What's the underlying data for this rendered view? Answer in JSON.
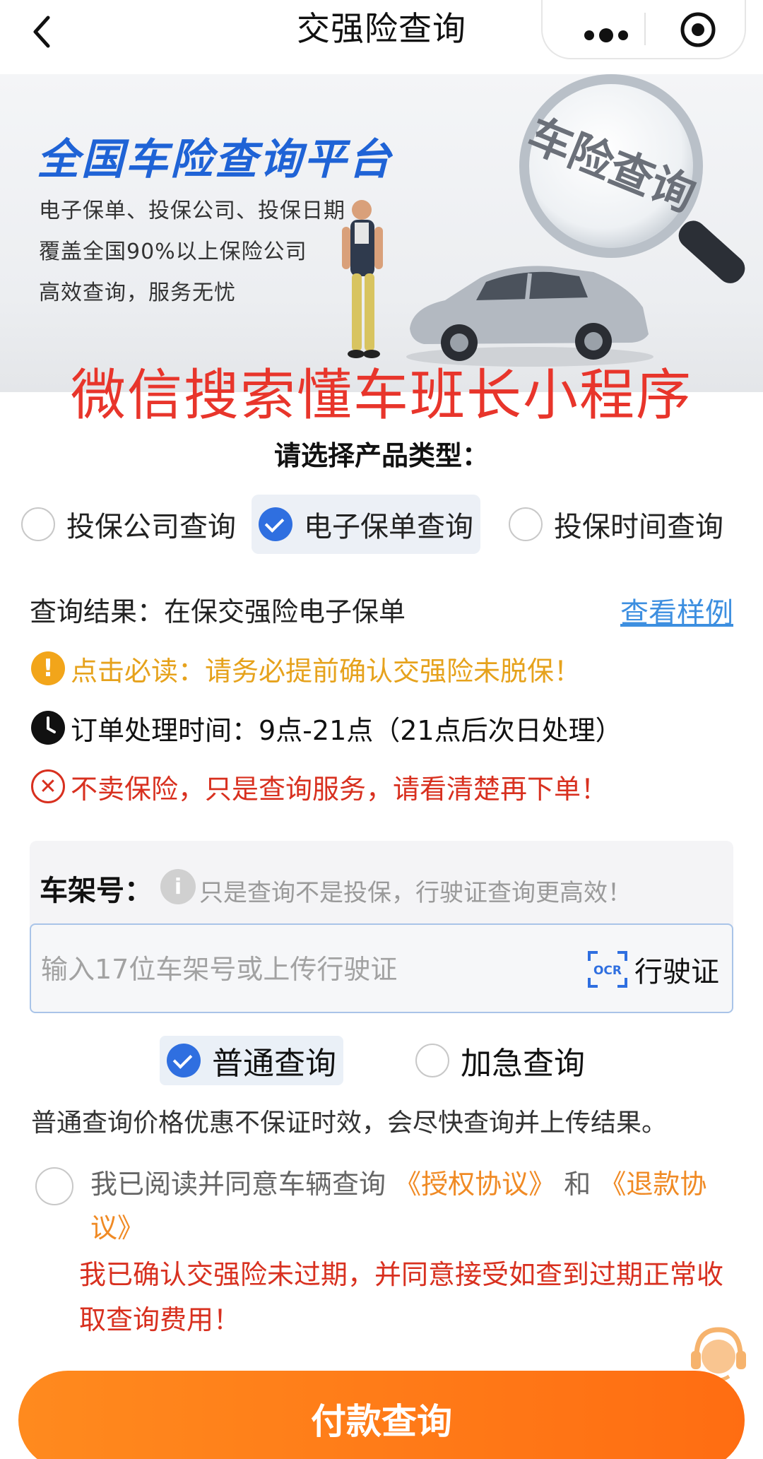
{
  "header": {
    "title": "交强险查询"
  },
  "banner": {
    "title": "全国车险查询平台",
    "lines": [
      "电子保单、投保公司、投保日期",
      "覆盖全国90%以上保险公司",
      "高效查询，服务无忧"
    ],
    "magnifier_text": "车险查询",
    "promo": "微信搜索懂车班长小程序"
  },
  "product": {
    "heading": "请选择产品类型：",
    "options": [
      {
        "label": "投保公司查询",
        "selected": false
      },
      {
        "label": "电子保单查询",
        "selected": true
      },
      {
        "label": "投保时间查询",
        "selected": false
      }
    ]
  },
  "result": {
    "text": "查询结果：在保交强险电子保单",
    "sample_link": "查看样例"
  },
  "notices": [
    {
      "icon": "exclamation-icon",
      "text": "点击必读：请务必提前确认交强险未脱保！",
      "color": "#e6a21c"
    },
    {
      "icon": "clock-icon",
      "text": "订单处理时间：9点-21点（21点后次日处理）",
      "color": "#111111"
    },
    {
      "icon": "close-circle-icon",
      "text": "不卖保险，只是查询服务，请看清楚再下单！",
      "color": "#d8301f"
    }
  ],
  "vin": {
    "label": "车架号：",
    "hint": "只是查询不是投保，行驶证查询更高效！",
    "placeholder": "输入17位车架号或上传行驶证",
    "value": "",
    "ocr_icon_text": "OCR",
    "ocr_label": "行驶证"
  },
  "query_type": {
    "options": [
      {
        "label": "普通查询",
        "selected": true
      },
      {
        "label": "加急查询",
        "selected": false
      }
    ],
    "description": "普通查询价格优惠不保证时效，会尽快查询并上传结果。"
  },
  "agreement": {
    "checked": false,
    "prefix": "我已阅读并同意车辆查询",
    "link1": "《授权协议》",
    "and": "和",
    "link2": "《退款协议》",
    "confirm": "我已确认交强险未过期，并同意接受如查到过期正常收取查询费用！"
  },
  "customer_service": {
    "label": "客服"
  },
  "pay_button": {
    "label": "付款查询"
  },
  "colors": {
    "accent_blue": "#2f6fe0",
    "link_blue": "#3d8fe0",
    "promo_red": "#e8352b",
    "warning_orange": "#f08a24",
    "pay_orange": "#ff7a18"
  }
}
